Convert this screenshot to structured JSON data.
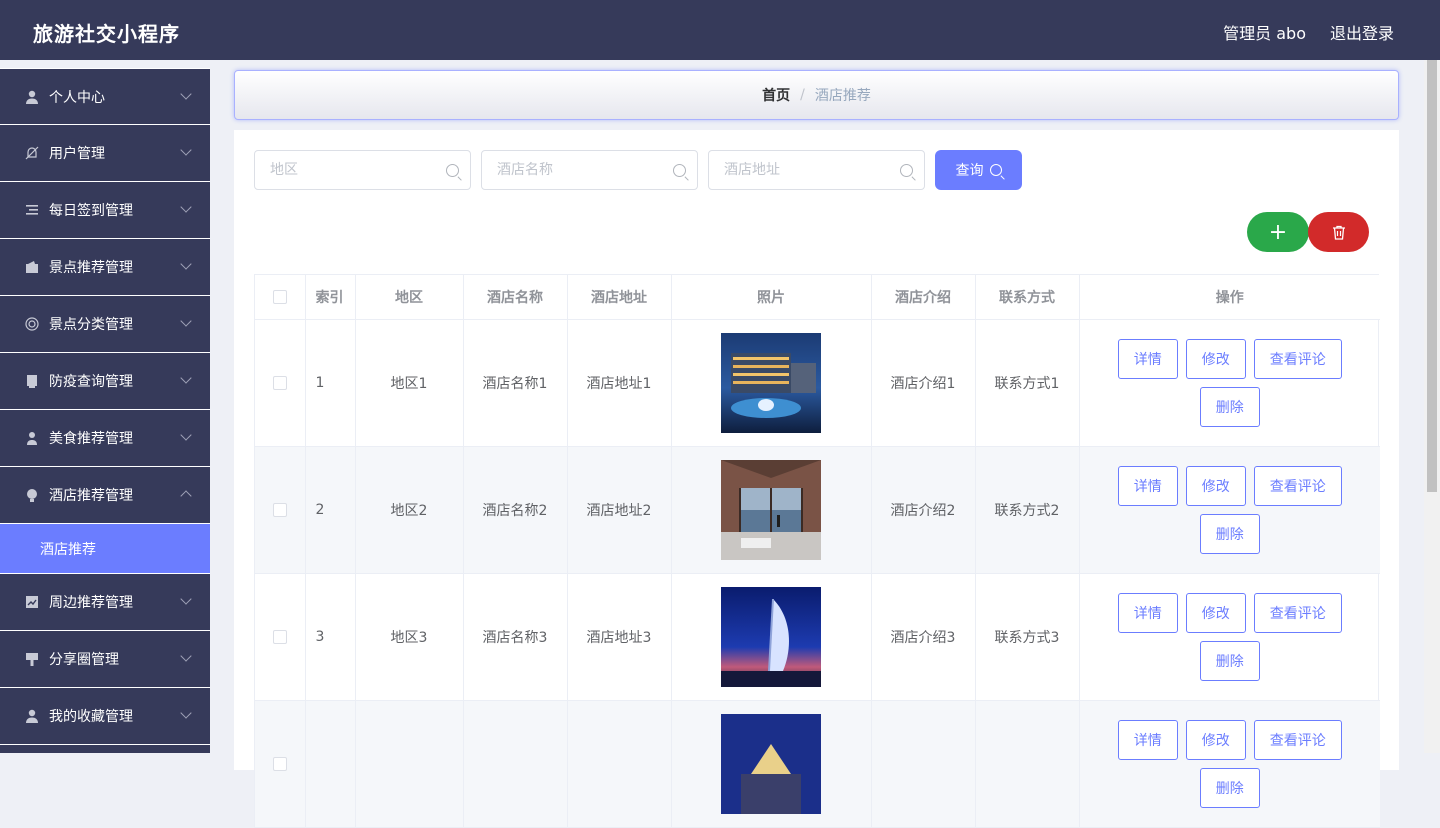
{
  "app": {
    "title": "旅游社交小程序"
  },
  "header": {
    "user_label": "管理员 abo",
    "logout_label": "退出登录"
  },
  "sidebar": {
    "items": [
      {
        "label": "个人中心",
        "icon": "user-icon"
      },
      {
        "label": "用户管理",
        "icon": "bell-off-icon"
      },
      {
        "label": "每日签到管理",
        "icon": "list-icon"
      },
      {
        "label": "景点推荐管理",
        "icon": "wallet-icon"
      },
      {
        "label": "景点分类管理",
        "icon": "lifebuoy-icon"
      },
      {
        "label": "防疫查询管理",
        "icon": "document-icon"
      },
      {
        "label": "美食推荐管理",
        "icon": "person-icon"
      },
      {
        "label": "酒店推荐管理",
        "icon": "bulb-icon",
        "expanded": true
      },
      {
        "label": "周边推荐管理",
        "icon": "chart-icon"
      },
      {
        "label": "分享圈管理",
        "icon": "pillar-icon"
      },
      {
        "label": "我的收藏管理",
        "icon": "user-solid-icon"
      }
    ],
    "subitem": {
      "label": "酒店推荐"
    }
  },
  "breadcrumb": {
    "home": "首页",
    "separator": "/",
    "current": "酒店推荐"
  },
  "search": {
    "region_placeholder": "地区",
    "name_placeholder": "酒店名称",
    "address_placeholder": "酒店地址",
    "query_label": "查询"
  },
  "actions": {
    "add_symbol": "+"
  },
  "table": {
    "headers": [
      "索引",
      "地区",
      "酒店名称",
      "酒店地址",
      "照片",
      "酒店介绍",
      "联系方式",
      "操作"
    ],
    "buttons": {
      "detail": "详情",
      "edit": "修改",
      "review": "查看评论",
      "delete": "删除"
    },
    "rows": [
      {
        "index": "1",
        "region": "地区1",
        "name": "酒店名称1",
        "address": "酒店地址1",
        "intro": "酒店介绍1",
        "contact": "联系方式1"
      },
      {
        "index": "2",
        "region": "地区2",
        "name": "酒店名称2",
        "address": "酒店地址2",
        "intro": "酒店介绍2",
        "contact": "联系方式2"
      },
      {
        "index": "3",
        "region": "地区3",
        "name": "酒店名称3",
        "address": "酒店地址3",
        "intro": "酒店介绍3",
        "contact": "联系方式3"
      },
      {
        "index": "",
        "region": "",
        "name": "",
        "address": "",
        "intro": "",
        "contact": ""
      }
    ]
  },
  "colors": {
    "sidebar": "#363a5a",
    "accent": "#6b7dff",
    "add": "#2aa84a",
    "delete": "#d22a2a"
  }
}
